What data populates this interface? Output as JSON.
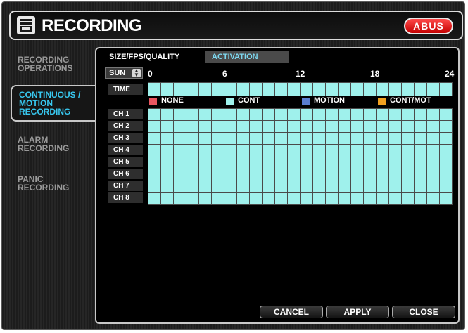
{
  "window": {
    "title": "RECORDING",
    "brand": "ABUS"
  },
  "sidebar": {
    "items": [
      {
        "label": "RECORDING OPERATIONS",
        "active": false
      },
      {
        "label": "CONTINUOUS / MOTION RECORDING",
        "active": true
      },
      {
        "label": "ALARM RECORDING",
        "active": false
      },
      {
        "label": "PANIC RECORDING",
        "active": false
      }
    ]
  },
  "tabs": [
    {
      "label": "SIZE/FPS/QUALITY",
      "active": false
    },
    {
      "label": "ACTIVATION",
      "active": true
    }
  ],
  "schedule": {
    "day": "SUN",
    "hour_labels": [
      "0",
      "6",
      "12",
      "18",
      "24"
    ],
    "time_label": "TIME",
    "channels": [
      "CH 1",
      "CH 2",
      "CH 3",
      "CH 4",
      "CH 5",
      "CH 6",
      "CH 7",
      "CH 8"
    ],
    "hours_per_row": 24,
    "fill_mode": "CONT"
  },
  "legend": [
    {
      "label": "NONE",
      "color": "#e8555f"
    },
    {
      "label": "CONT",
      "color": "#9ff1ec"
    },
    {
      "label": "MOTION",
      "color": "#5a7ed0"
    },
    {
      "label": "CONT/MOT",
      "color": "#f0a020"
    }
  ],
  "buttons": {
    "cancel": "CANCEL",
    "apply": "APPLY",
    "close": "CLOSE"
  },
  "colors": {
    "cont_cell": "#9ff1ec",
    "active_text": "#38c8f0",
    "logo_red": "#e01010"
  }
}
